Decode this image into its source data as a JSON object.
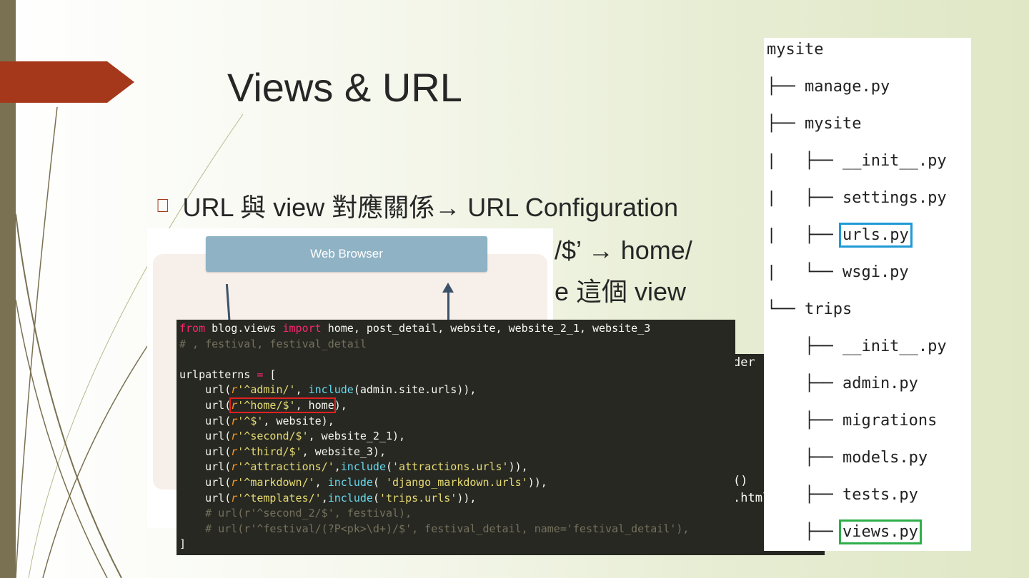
{
  "slide": {
    "title": "Views & URL",
    "bullet_mark": "",
    "bullet_text": "URL 與 view 對應關係→ URL Configuration",
    "sub_line_1": "/$’ → home/",
    "sub_line_2": "e 這個 view"
  },
  "diagram": {
    "browser_label": "Web Browser"
  },
  "code_back": {
    "line1": "der",
    "line2": "()",
    "line3": ".html', {"
  },
  "code": {
    "l1_from": "from",
    "l1_mod": " blog.views ",
    "l1_import": "import",
    "l1_rest": " home, post_detail, website, website_2_1, website_3",
    "l2": "# , festival, festival_detail",
    "l4_name": "urlpatterns ",
    "l4_eq": "=",
    "l4_br": " [",
    "l5_a": "    url(",
    "l5_r": "r",
    "l5_s": "'^admin/'",
    "l5_b": ", ",
    "l5_inc": "include",
    "l5_c": "(admin.site.urls)),",
    "l6_a": "    url(",
    "l6_r": "r",
    "l6_s": "'^home/$'",
    "l6_b": ", home",
    "l6_c": "),",
    "l7_a": "    url(",
    "l7_r": "r",
    "l7_s": "'^$'",
    "l7_c": ", website),",
    "l8_a": "    url(",
    "l8_r": "r",
    "l8_s": "'^second/$'",
    "l8_c": ", website_2_1),",
    "l9_a": "    url(",
    "l9_r": "r",
    "l9_s": "'^third/$'",
    "l9_c": ", website_3),",
    "l10_a": "    url(",
    "l10_r": "r",
    "l10_s": "'^attractions/'",
    "l10_b": ",",
    "l10_inc": "include",
    "l10_p": "(",
    "l10_s2": "'attractions.urls'",
    "l10_c": ")),",
    "l11_a": "    url(",
    "l11_r": "r",
    "l11_s": "'^markdown/'",
    "l11_b": ", ",
    "l11_inc": "include",
    "l11_p": "( ",
    "l11_s2": "'django_markdown.urls'",
    "l11_c": ")),",
    "l12_a": "    url(",
    "l12_r": "r",
    "l12_s": "'^templates/'",
    "l12_b": ",",
    "l12_inc": "include",
    "l12_p": "(",
    "l12_s2": "'trips.urls'",
    "l12_c": ")),",
    "l13": "    # url(r'^second_2/$', festival),",
    "l14": "    # url(r'^festival/(?P<pk>\\d+)/$', festival_detail, name='festival_detail'),",
    "l15": "]"
  },
  "tree": {
    "rows": [
      "mysite",
      "├── manage.py",
      "├── mysite",
      "|   ├── __init__.py",
      "|   ├── settings.py",
      "|   ├── urls.py",
      "|   └── wsgi.py",
      "└── trips",
      "    ├── __init__.py",
      "    ├── admin.py",
      "    ├── migrations",
      "    ├── models.py",
      "    ├── tests.py",
      "    ├── views.py"
    ],
    "urls_label": "urls.py",
    "views_label": "views.py",
    "highlight_blue": "#1f9ad6",
    "highlight_green": "#2fae4a"
  }
}
